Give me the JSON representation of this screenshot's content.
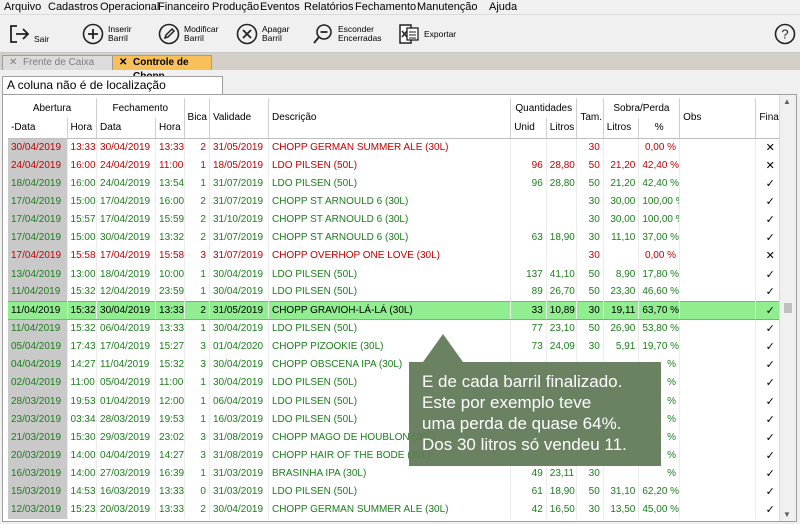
{
  "menu": [
    "Arquivo",
    "Cadastros",
    "Operacional",
    "Financeiro",
    "Produção",
    "Eventos",
    "Relatórios",
    "Fechamento",
    "Manutenção",
    "Ajuda"
  ],
  "toolbar": {
    "sair": "Sair",
    "inserir1": "Inserir",
    "inserir2": "Barril",
    "modificar1": "Modificar",
    "modificar2": "Barril",
    "apagar1": "Apagar",
    "apagar2": "Barril",
    "esconder1": "Esconder",
    "esconder2": "Encerradas",
    "exportar": "Exportar",
    "help": "?"
  },
  "tabs": {
    "t1": "Frente de Caixa",
    "t2": "Controle de Chopp"
  },
  "message": "A coluna não é de localização incremental.",
  "headers": {
    "abertura": "Abertura",
    "fechamento": "Fechamento",
    "quantidades": "Quantidades",
    "sobra_perda": "Sobra/Perda",
    "data": "-Data",
    "hora": "Hora",
    "fdata": "Data",
    "fhora": "Hora",
    "bica": "Bica",
    "validade": "Validade",
    "descricao": "Descrição",
    "unid": "Unid",
    "litros": "Litros",
    "tam": "Tam.",
    "slitros": "Litros",
    "pct": "%",
    "obs": "Obs",
    "final": "Final."
  },
  "rows": [
    {
      "d": "30/04/2019",
      "h": "13:33",
      "fd": "30/04/2019",
      "fh": "13:33",
      "b": "2",
      "v": "31/05/2019",
      "desc": "CHOPP GERMAN SUMMER ALE (30L)",
      "u": "",
      "l": "",
      "t": "30",
      "sl": "",
      "p": "0,00 %",
      "f": "✕",
      "c": "red"
    },
    {
      "d": "24/04/2019",
      "h": "16:00",
      "fd": "24/04/2019",
      "fh": "11:00",
      "b": "1",
      "v": "18/05/2019",
      "desc": "LDO PILSEN (50L)",
      "u": "96",
      "l": "28,80",
      "t": "50",
      "sl": "21,20",
      "p": "42,40 %",
      "f": "✕",
      "c": "red"
    },
    {
      "d": "18/04/2019",
      "h": "16:00",
      "fd": "24/04/2019",
      "fh": "13:54",
      "b": "1",
      "v": "31/07/2019",
      "desc": "LDO PILSEN (50L)",
      "u": "96",
      "l": "28,80",
      "t": "50",
      "sl": "21,20",
      "p": "42,40 %",
      "f": "✓",
      "c": "grn"
    },
    {
      "d": "17/04/2019",
      "h": "15:00",
      "fd": "17/04/2019",
      "fh": "16:00",
      "b": "2",
      "v": "31/07/2019",
      "desc": "CHOPP ST ARNOULD 6 (30L)",
      "u": "",
      "l": "",
      "t": "30",
      "sl": "30,00",
      "p": "100,00 %",
      "f": "✓",
      "c": "grn"
    },
    {
      "d": "17/04/2019",
      "h": "15:57",
      "fd": "17/04/2019",
      "fh": "15:59",
      "b": "2",
      "v": "31/10/2019",
      "desc": "CHOPP ST ARNOULD 6 (30L)",
      "u": "",
      "l": "",
      "t": "30",
      "sl": "30,00",
      "p": "100,00 %",
      "f": "✓",
      "c": "grn"
    },
    {
      "d": "17/04/2019",
      "h": "15:00",
      "fd": "30/04/2019",
      "fh": "13:32",
      "b": "2",
      "v": "31/07/2019",
      "desc": "CHOPP ST ARNOULD 6 (30L)",
      "u": "63",
      "l": "18,90",
      "t": "30",
      "sl": "11,10",
      "p": "37,00 %",
      "f": "✓",
      "c": "grn"
    },
    {
      "d": "17/04/2019",
      "h": "15:58",
      "fd": "17/04/2019",
      "fh": "15:58",
      "b": "3",
      "v": "31/07/2019",
      "desc": "CHOPP OVERHOP ONE LOVE (30L)",
      "u": "",
      "l": "",
      "t": "30",
      "sl": "",
      "p": "0,00 %",
      "f": "✕",
      "c": "red"
    },
    {
      "d": "13/04/2019",
      "h": "13:00",
      "fd": "18/04/2019",
      "fh": "10:00",
      "b": "1",
      "v": "30/04/2019",
      "desc": "LDO PILSEN (50L)",
      "u": "137",
      "l": "41,10",
      "t": "50",
      "sl": "8,90",
      "p": "17,80 %",
      "f": "✓",
      "c": "grn"
    },
    {
      "d": "11/04/2019",
      "h": "15:32",
      "fd": "12/04/2019",
      "fh": "23:59",
      "b": "1",
      "v": "30/04/2019",
      "desc": "LDO PILSEN (50L)",
      "u": "89",
      "l": "26,70",
      "t": "50",
      "sl": "23,30",
      "p": "46,60 %",
      "f": "✓",
      "c": "grn"
    },
    {
      "d": "11/04/2019",
      "h": "15:32",
      "fd": "30/04/2019",
      "fh": "13:33",
      "b": "2",
      "v": "31/05/2019",
      "desc": "CHOPP GRAVIOH-LÁ-LÁ (30L)",
      "u": "33",
      "l": "10,89",
      "t": "30",
      "sl": "19,11",
      "p": "63,70 %",
      "f": "✓",
      "c": "sel"
    },
    {
      "d": "11/04/2019",
      "h": "15:32",
      "fd": "06/04/2019",
      "fh": "13:33",
      "b": "1",
      "v": "30/04/2019",
      "desc": "LDO PILSEN (50L)",
      "u": "77",
      "l": "23,10",
      "t": "50",
      "sl": "26,90",
      "p": "53,80 %",
      "f": "✓",
      "c": "grn"
    },
    {
      "d": "05/04/2019",
      "h": "17:43",
      "fd": "17/04/2019",
      "fh": "15:27",
      "b": "3",
      "v": "01/04/2020",
      "desc": "CHOPP PIZOOKIE (30L)",
      "u": "73",
      "l": "24,09",
      "t": "30",
      "sl": "5,91",
      "p": "19,70 %",
      "f": "✓",
      "c": "grn"
    },
    {
      "d": "04/04/2019",
      "h": "14:27",
      "fd": "11/04/2019",
      "fh": "15:32",
      "b": "3",
      "v": "30/04/2019",
      "desc": "CHOPP OBSCENA IPA (30L)",
      "u": "",
      "l": "",
      "t": "",
      "sl": "",
      "p": "%",
      "f": "✓",
      "c": "grn"
    },
    {
      "d": "02/04/2019",
      "h": "11:00",
      "fd": "05/04/2019",
      "fh": "11:00",
      "b": "1",
      "v": "30/04/2019",
      "desc": "LDO PILSEN (50L)",
      "u": "",
      "l": "",
      "t": "",
      "sl": "",
      "p": "%",
      "f": "✓",
      "c": "grn"
    },
    {
      "d": "28/03/2019",
      "h": "19:53",
      "fd": "01/04/2019",
      "fh": "12:00",
      "b": "1",
      "v": "06/04/2019",
      "desc": "LDO PILSEN (50L)",
      "u": "",
      "l": "",
      "t": "",
      "sl": "",
      "p": "%",
      "f": "✓",
      "c": "grn"
    },
    {
      "d": "23/03/2019",
      "h": "03:34",
      "fd": "28/03/2019",
      "fh": "19:53",
      "b": "1",
      "v": "16/03/2019",
      "desc": "LDO PILSEN (50L)",
      "u": "",
      "l": "",
      "t": "",
      "sl": "",
      "p": "%",
      "f": "✓",
      "c": "grn"
    },
    {
      "d": "21/03/2019",
      "h": "15:30",
      "fd": "29/03/2019",
      "fh": "23:02",
      "b": "3",
      "v": "31/08/2019",
      "desc": "CHOPP MAGO DE HOUBLON (30L)",
      "u": "",
      "l": "",
      "t": "",
      "sl": "",
      "p": "%",
      "f": "✓",
      "c": "grn"
    },
    {
      "d": "20/03/2019",
      "h": "14:00",
      "fd": "04/04/2019",
      "fh": "14:27",
      "b": "3",
      "v": "31/08/2019",
      "desc": "CHOPP HAIR OF THE BODE (30L)",
      "u": "",
      "l": "",
      "t": "",
      "sl": "",
      "p": "%",
      "f": "✓",
      "c": "grn"
    },
    {
      "d": "16/03/2019",
      "h": "14:00",
      "fd": "27/03/2019",
      "fh": "16:39",
      "b": "1",
      "v": "31/03/2019",
      "desc": "BRASINHA IPA (30L)",
      "u": "49",
      "l": "23,11",
      "t": "30",
      "sl": "",
      "p": "%",
      "f": "✓",
      "c": "grn"
    },
    {
      "d": "15/03/2019",
      "h": "14:53",
      "fd": "16/03/2019",
      "fh": "13:33",
      "b": "0",
      "v": "31/03/2019",
      "desc": "LDO PILSEN (50L)",
      "u": "61",
      "l": "18,90",
      "t": "50",
      "sl": "31,10",
      "p": "62,20 %",
      "f": "✓",
      "c": "grn"
    },
    {
      "d": "12/03/2019",
      "h": "15:23",
      "fd": "20/03/2019",
      "fh": "13:33",
      "b": "2",
      "v": "30/04/2019",
      "desc": "CHOPP GERMAN SUMMER ALE (30L)",
      "u": "42",
      "l": "16,50",
      "t": "30",
      "sl": "13,50",
      "p": "45,00 %",
      "f": "✓",
      "c": "grn"
    }
  ],
  "callout": {
    "l1": "E de cada barril finalizado.",
    "l2": "Este por exemplo teve",
    "l3": "uma perda de quase 64%.",
    "l4": "Dos 30 litros só vendeu 11."
  },
  "colors": {
    "tab_active": "#f7c05a",
    "selected_row": "#90ee90",
    "red_text": "#c00000",
    "green_text": "#1a7d1a",
    "callout_bg": "#607856"
  }
}
